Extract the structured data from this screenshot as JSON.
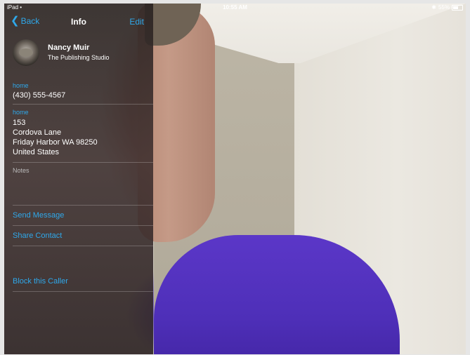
{
  "status_bar": {
    "device": "iPad",
    "time": "10:55 AM",
    "battery": "55%",
    "battery_level": 0.55
  },
  "nav": {
    "back_label": "Back",
    "title": "Info",
    "edit_label": "Edit"
  },
  "contact": {
    "name": "Nancy Muir",
    "company": "The Publishing Studio",
    "phone": {
      "label": "home",
      "value": "(430) 555-4567"
    },
    "address": {
      "label": "home",
      "lines": [
        "153",
        "Cordova Lane",
        "Friday Harbor WA 98250",
        "United States"
      ]
    },
    "notes_label": "Notes"
  },
  "actions": {
    "send_message": "Send Message",
    "share_contact": "Share Contact",
    "block_caller": "Block this Caller"
  },
  "colors": {
    "accent": "#2fa8ea"
  }
}
